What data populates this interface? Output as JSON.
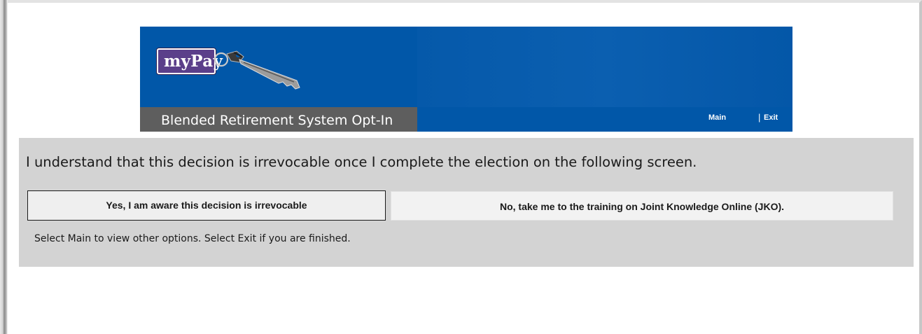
{
  "header": {
    "logo_text": "myPay",
    "logo_icon": "key-icon",
    "page_title": "Blended Retirement System Opt-In",
    "nav": {
      "main_label": "Main",
      "separator": "|",
      "exit_label": "Exit"
    }
  },
  "main": {
    "prompt": "I understand that this decision is irrevocable once I complete the election on the following screen.",
    "buttons": {
      "yes_label": "Yes, I am aware this decision is irrevocable",
      "no_label": "No, take me to the training on Joint Knowledge Online (JKO)."
    },
    "hint": "Select Main to view other options. Select Exit if you are finished."
  },
  "colors": {
    "banner_blue": "#0157a8",
    "subbar_gray": "#5e5e5e",
    "panel_gray": "#d3d3d3",
    "logo_purple": "#5b3f8a"
  }
}
